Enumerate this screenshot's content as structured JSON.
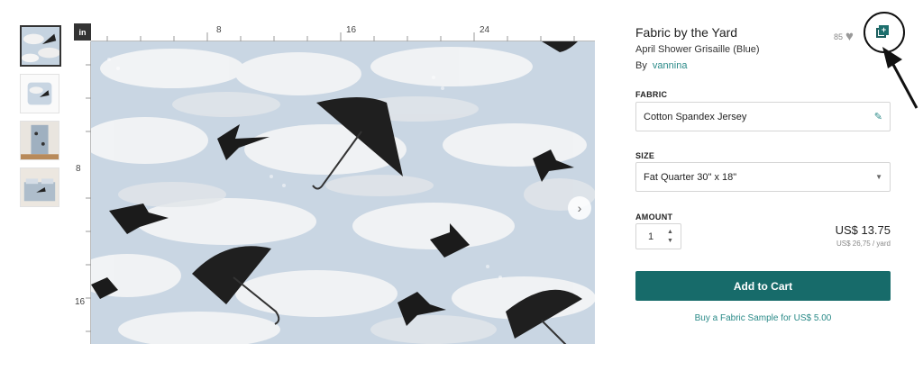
{
  "viewer": {
    "unit": "in",
    "ruler_top": [
      "8",
      "16",
      "24"
    ],
    "ruler_left": [
      "8",
      "16"
    ],
    "next_glyph": "›"
  },
  "thumbnails": [
    "fabric-swatch",
    "pillow",
    "curtain",
    "duvet"
  ],
  "product": {
    "title": "Fabric by the Yard",
    "design_name": "April Shower Grisaille (Blue)",
    "by_label": "By",
    "designer": "vannina",
    "favorites_count": "85",
    "heart_glyph": "♥"
  },
  "fabric": {
    "label": "FABRIC",
    "value": "Cotton Spandex Jersey",
    "edit_glyph": "✎"
  },
  "size": {
    "label": "SIZE",
    "value": "Fat Quarter 30\" x 18\"",
    "caret": "▼"
  },
  "amount": {
    "label": "AMOUNT",
    "quantity": "1",
    "up": "▲",
    "down": "▼",
    "price": "US$ 13.75",
    "price_per_yard": "US$ 26,75 / yard"
  },
  "actions": {
    "add_to_cart": "Add to Cart",
    "sample_link": "Buy a Fabric Sample for US$ 5.00"
  },
  "colors": {
    "brand_teal": "#176b6a",
    "link_teal": "#2a8a88",
    "fabric_sky": "#c9d6e3"
  }
}
